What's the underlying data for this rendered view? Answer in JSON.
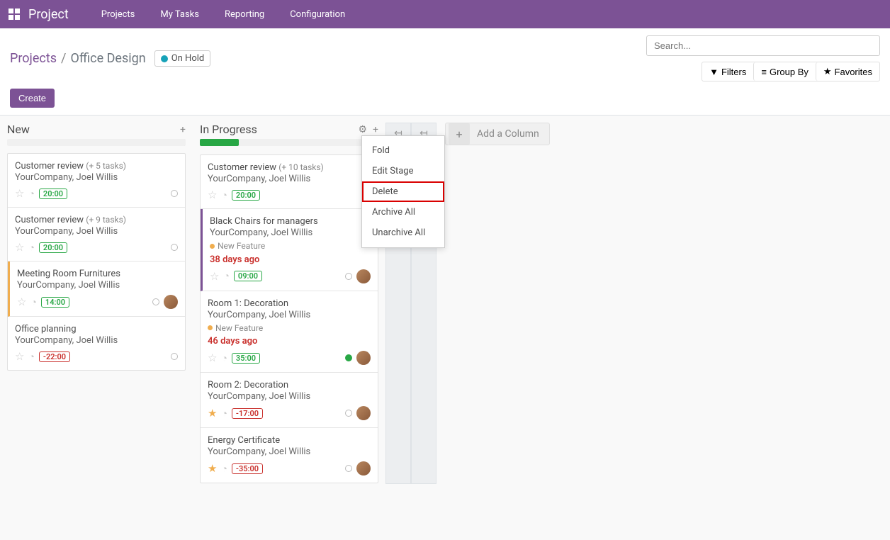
{
  "topbar": {
    "app_name": "Project",
    "nav": [
      "Projects",
      "My Tasks",
      "Reporting",
      "Configuration"
    ]
  },
  "breadcrumb": {
    "parent": "Projects",
    "current": "Office Design"
  },
  "status": {
    "label": "On Hold"
  },
  "search": {
    "placeholder": "Search..."
  },
  "filters": {
    "filters": "Filters",
    "group_by": "Group By",
    "favorites": "Favorites"
  },
  "create_label": "Create",
  "columns": {
    "new": {
      "title": "New",
      "count": "4",
      "cards": [
        {
          "title": "Customer review",
          "extra": "(+ 5 tasks)",
          "sub": "YourCompany, Joel Willis",
          "time": "20:00"
        },
        {
          "title": "Customer review",
          "extra": "(+ 9 tasks)",
          "sub": "YourCompany, Joel Willis",
          "time": "20:00"
        },
        {
          "title": "Meeting Room Furnitures",
          "sub": "YourCompany, Joel Willis",
          "time": "14:00"
        },
        {
          "title": "Office planning",
          "sub": "YourCompany, Joel Willis",
          "time": "-22:00"
        }
      ]
    },
    "in_progress": {
      "title": "In Progress",
      "cards": [
        {
          "title": "Customer review",
          "extra": "(+ 10 tasks)",
          "sub": "YourCompany, Joel Willis",
          "time": "20:00"
        },
        {
          "title": "Black Chairs for managers",
          "sub": "YourCompany, Joel Willis",
          "tag": "New Feature",
          "age": "38 days ago",
          "time": "09:00"
        },
        {
          "title": "Room 1: Decoration",
          "sub": "YourCompany, Joel Willis",
          "tag": "New Feature",
          "age": "46 days ago",
          "time": "35:00"
        },
        {
          "title": "Room 2: Decoration",
          "sub": "YourCompany, Joel Willis",
          "time": "-17:00"
        },
        {
          "title": "Energy Certificate",
          "sub": "YourCompany, Joel Willis",
          "time": "-35:00"
        }
      ]
    }
  },
  "dropdown": {
    "items": [
      "Fold",
      "Edit Stage",
      "Delete",
      "Archive All",
      "Unarchive All"
    ]
  },
  "add_column": "Add a Column"
}
